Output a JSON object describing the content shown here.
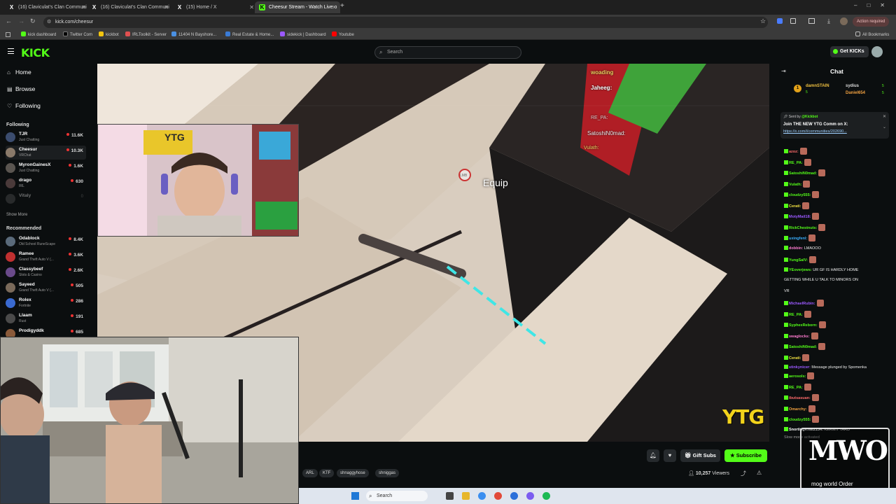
{
  "browser": {
    "tabs": [
      {
        "title": "(16) Claviculat's Clan Communi",
        "icon": "x-logo-icon"
      },
      {
        "title": "(16) Claviculat's Clan Communi",
        "icon": "x-logo-icon"
      },
      {
        "title": "(15) Home / X",
        "icon": "x-logo-icon"
      },
      {
        "title": "Cheesur Stream - Watch Live o",
        "icon": "kick-logo-icon"
      }
    ],
    "url": "kick.com/cheesur",
    "action_required": "Action required",
    "bookmarks": [
      "kick dashboard",
      "Twitter Com",
      "kickbot",
      "IRLToolkit - Server",
      "11404 N Bayshore...",
      "Real Estate & Home...",
      "sidekick | Dashboard",
      "Youtube"
    ],
    "all_bookmarks": "All Bookmarks"
  },
  "kick": {
    "logo": "KICK",
    "search_placeholder": "Search",
    "get_kicks": "Get KICKs"
  },
  "sidebar": {
    "nav": [
      {
        "label": "Home",
        "icon": "home-icon"
      },
      {
        "label": "Browse",
        "icon": "browse-icon"
      },
      {
        "label": "Following",
        "icon": "heart-icon"
      }
    ],
    "following_heading": "Following",
    "following": [
      {
        "name": "TJR",
        "sub": "Just Chatting",
        "viewers": "11.6K"
      },
      {
        "name": "Cheesur",
        "sub": "VRChat",
        "viewers": "10.3K"
      },
      {
        "name": "MyronGainesX",
        "sub": "Just Chatting",
        "viewers": "1.6K"
      },
      {
        "name": "drago",
        "sub": "IRL",
        "viewers": "630"
      },
      {
        "name": "Vitaly",
        "sub": "",
        "viewers": "0"
      }
    ],
    "show_more": "Show More",
    "recommended_heading": "Recommended",
    "recommended": [
      {
        "name": "Odablock",
        "sub": "Old School RuneScape",
        "viewers": "8.4K"
      },
      {
        "name": "Ramee",
        "sub": "Grand Theft Auto V (...",
        "viewers": "3.6K"
      },
      {
        "name": "Classybeef",
        "sub": "Slots & Casino",
        "viewers": "2.6K"
      },
      {
        "name": "Sayeed",
        "sub": "Grand Theft Auto V (...",
        "viewers": "505"
      },
      {
        "name": "Rolex",
        "sub": "Fortnite",
        "viewers": "286"
      },
      {
        "name": "Llaam",
        "sub": "Rust",
        "viewers": "191"
      },
      {
        "name": "Prodigyddk",
        "sub": "",
        "viewers": "685"
      }
    ]
  },
  "stream": {
    "game_prompt": "Equip",
    "prompt_key": "LMB",
    "watermark": "YTG",
    "poster_text": "YTG",
    "nameplates": [
      "woading",
      "Jaheeg:",
      "RE_PA:",
      "SatoshiN0mad:",
      "Vulath:"
    ]
  },
  "under_player": {
    "gift_subs": "Gift Subs",
    "subscribe": "Subscribe",
    "viewers": "10,257",
    "viewers_label": "Viewers",
    "tags": [
      "ARL",
      "KTF",
      "shnaggyhose",
      "shniggas"
    ]
  },
  "chat": {
    "title": "Chat",
    "top_gifters": [
      {
        "rank": "1",
        "name": "damnSTAIN",
        "count": "5"
      },
      {
        "name": "sydius",
        "count": "5"
      },
      {
        "name": "Daniel654",
        "count": "5"
      }
    ],
    "pinned": {
      "sent_by": "Sent by",
      "author": "@Kickbot",
      "text": "Join THE NEW YTG Comm on X:",
      "link": "https://x.com/i/communities/202690..."
    },
    "messages": [
      {
        "user": "azoz:",
        "text": "",
        "color": "#ff6b6b"
      },
      {
        "user": "RE_PA:",
        "text": "",
        "color": "#53fc18"
      },
      {
        "user": "SatoshiN0mad:",
        "text": "",
        "color": "#53fc18"
      },
      {
        "user": "Vulath:",
        "text": "",
        "color": "#53fc18"
      },
      {
        "user": "cloudzy555:",
        "text": "",
        "color": "#53fc18"
      },
      {
        "user": "Cerati:",
        "text": "",
        "color": "#f0e040"
      },
      {
        "user": "MotyMail18:",
        "text": "",
        "color": "#9b59ff"
      },
      {
        "user": "RickChestnuts:",
        "text": "",
        "color": "#53fc18"
      },
      {
        "user": "uxingfenl:",
        "text": "",
        "color": "#3ab0ff"
      },
      {
        "user": "dobbin:",
        "text": "LMAOOO",
        "color": "#ff7bd0"
      },
      {
        "user": "YungSalV:",
        "text": "",
        "color": "#53fc18"
      },
      {
        "user": "YEoverjews:",
        "text": "UR GF IS HARDLY HOME",
        "color": "#53fc18"
      },
      {
        "user": "",
        "text": "GETTING WHILE U TALK TO MINORS ON",
        "color": "#fff"
      },
      {
        "user": "",
        "text": "VR",
        "color": "#fff"
      },
      {
        "user": "MichaelRubin:",
        "text": "",
        "color": "#9b59ff"
      },
      {
        "user": "RE_PA:",
        "text": "",
        "color": "#53fc18"
      },
      {
        "user": "SyphexReborn:",
        "text": "",
        "color": "#53fc18"
      },
      {
        "user": "swaglocks:",
        "text": "",
        "color": "#ff7bd0"
      },
      {
        "user": "SatoshiN0mad:",
        "text": "",
        "color": "#53fc18"
      },
      {
        "user": "Cerati:",
        "text": "",
        "color": "#f0e040"
      },
      {
        "user": "stinkynicer:",
        "text": "Message plunged by Spomenka",
        "color": "#9b59ff"
      },
      {
        "user": "aerosols:",
        "text": "",
        "color": "#53fc18"
      },
      {
        "user": "RE_PA:",
        "text": "",
        "color": "#53fc18"
      },
      {
        "user": "ibutsasuan:",
        "text": "",
        "color": "#ff6b6b"
      },
      {
        "user": "Omarchy:",
        "text": "",
        "color": "#f0a040"
      },
      {
        "user": "cloudzy555:",
        "text": "",
        "color": "#53fc18"
      },
      {
        "user": "SnortingKhat2134:",
        "text": "KERMIT TARD",
        "color": "#fff"
      }
    ],
    "slow_mode": "Slow mode activated"
  },
  "overlay_logo": "mog world Order",
  "taskbar": {
    "search": "Search"
  }
}
